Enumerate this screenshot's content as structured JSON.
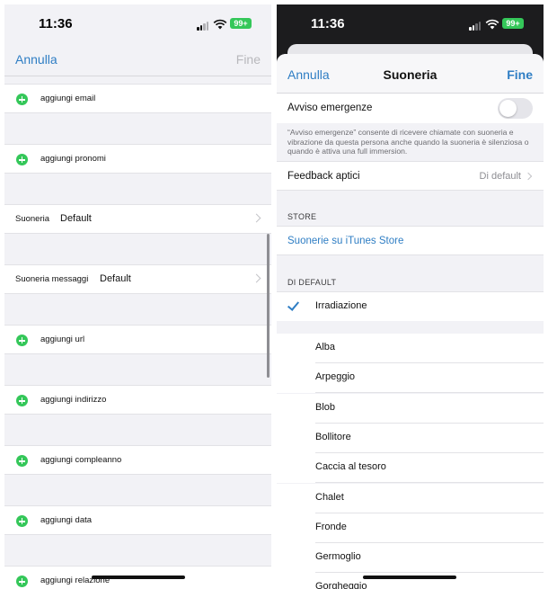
{
  "left": {
    "status": {
      "time": "11:36",
      "battery": "99+"
    },
    "nav": {
      "cancel": "Annulla",
      "done": "Fine"
    },
    "rows": {
      "email": "aggiungi email",
      "pronouns": "aggiungi pronomi",
      "ringtone_label": "Suoneria",
      "ringtone_value": "Default",
      "msg_tone_label": "Suoneria messaggi",
      "msg_tone_value": "Default",
      "url": "aggiungi url",
      "address": "aggiungi indirizzo",
      "birthday": "aggiungi compleanno",
      "date": "aggiungi data",
      "relation": "aggiungi relazione"
    }
  },
  "right": {
    "status": {
      "time": "11:36",
      "battery": "99+"
    },
    "nav": {
      "cancel": "Annulla",
      "title": "Suoneria",
      "done": "Fine"
    },
    "emergency_label": "Avviso emergenze",
    "emergency_note": "“Avviso emergenze” consente di ricevere chiamate con suoneria e vibrazione da questa persona anche quando la suoneria è silenziosa o quando è attiva una full immersion.",
    "haptic_label": "Feedback aptici",
    "haptic_value": "Di default",
    "store_header": "STORE",
    "store_link": "Suonerie su iTunes Store",
    "default_header": "DI DEFAULT",
    "selected_tone": "Irradiazione",
    "tones": [
      "Alba",
      "Arpeggio",
      "Blob",
      "Bollitore",
      "Caccia al tesoro",
      "Chalet",
      "Fronde",
      "Germoglio",
      "Gorgheggio"
    ]
  },
  "colors": {
    "accent": "#2f7ec4",
    "green": "#34c759",
    "background": "#f2f2f6"
  }
}
